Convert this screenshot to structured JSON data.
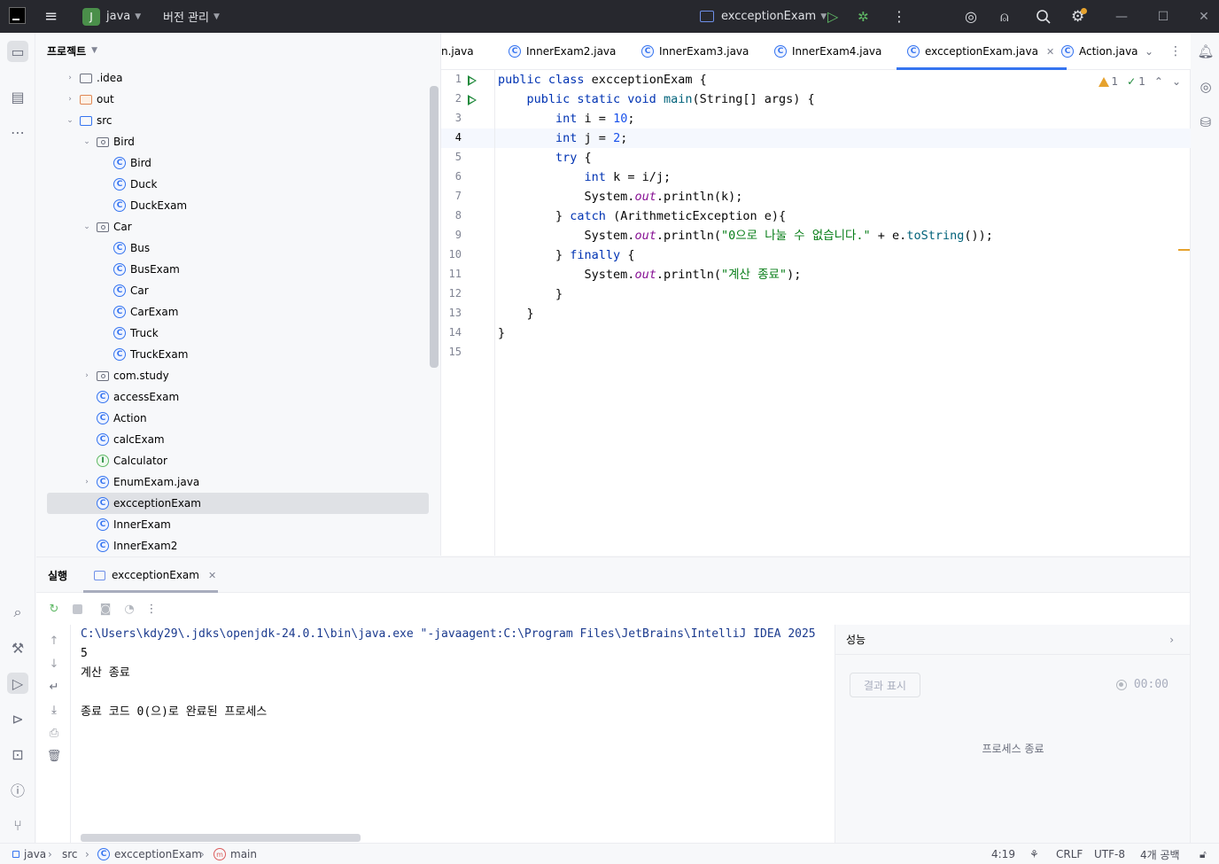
{
  "titlebar": {
    "project_initial": "J",
    "project_name": "java",
    "vcs_menu": "버전 관리",
    "run_config": "excceptionExam"
  },
  "project_panel": {
    "title": "프로젝트",
    "tree": [
      {
        "label": ".idea",
        "icon": "folder-icon"
      },
      {
        "label": "out",
        "icon": "folder-excluded-icon"
      },
      {
        "label": "src",
        "icon": "source-folder-icon"
      },
      {
        "label": "Bird",
        "icon": "package-icon"
      },
      {
        "label": "Bird",
        "icon": "class-icon"
      },
      {
        "label": "Duck",
        "icon": "class-icon"
      },
      {
        "label": "DuckExam",
        "icon": "runnable-class-icon"
      },
      {
        "label": "Car",
        "icon": "package-icon"
      },
      {
        "label": "Bus",
        "icon": "class-icon"
      },
      {
        "label": "BusExam",
        "icon": "runnable-class-icon"
      },
      {
        "label": "Car",
        "icon": "class-icon"
      },
      {
        "label": "CarExam",
        "icon": "runnable-class-icon"
      },
      {
        "label": "Truck",
        "icon": "class-icon"
      },
      {
        "label": "TruckExam",
        "icon": "runnable-class-icon"
      },
      {
        "label": "com.study",
        "icon": "package-icon"
      },
      {
        "label": "accessExam",
        "icon": "runnable-class-icon"
      },
      {
        "label": "Action",
        "icon": "runnable-class-icon"
      },
      {
        "label": "calcExam",
        "icon": "runnable-class-icon"
      },
      {
        "label": "Calculator",
        "icon": "interface-icon"
      },
      {
        "label": "EnumExam.java",
        "icon": "runnable-class-icon"
      },
      {
        "label": "excceptionExam",
        "icon": "runnable-class-icon"
      },
      {
        "label": "InnerExam",
        "icon": "runnable-class-icon"
      },
      {
        "label": "InnerExam2",
        "icon": "runnable-class-icon"
      }
    ]
  },
  "editor": {
    "tabs": [
      {
        "label": "n.java"
      },
      {
        "label": "InnerExam2.java"
      },
      {
        "label": "InnerExam3.java"
      },
      {
        "label": "InnerExam4.java"
      },
      {
        "label": "excceptionExam.java"
      },
      {
        "label": "Action.java"
      }
    ],
    "line_numbers": [
      "1",
      "2",
      "3",
      "4",
      "5",
      "6",
      "7",
      "8",
      "9",
      "10",
      "11",
      "12",
      "13",
      "14",
      "15"
    ],
    "inspections": {
      "warnings": "1",
      "ok": "1"
    }
  },
  "run_panel": {
    "title": "실행",
    "tab": "excceptionExam",
    "console": [
      "C:\\Users\\kdy29\\.jdks\\openjdk-24.0.1\\bin\\java.exe \"-javaagent:C:\\Program Files\\JetBrains\\IntelliJ IDEA 2025",
      "5",
      "계산 종료",
      "",
      "종료 코드 0(으)로 완료된 프로세스"
    ],
    "perf": {
      "title": "성능",
      "show_results": "결과 표시",
      "timer": "00:00",
      "message": "프로세스 종료"
    }
  },
  "statusbar": {
    "crumbs": [
      "java",
      "src",
      "excceptionExam",
      "main"
    ],
    "position": "4:19",
    "line_sep": "CRLF",
    "encoding": "UTF-8",
    "indent": "4개 공백"
  }
}
